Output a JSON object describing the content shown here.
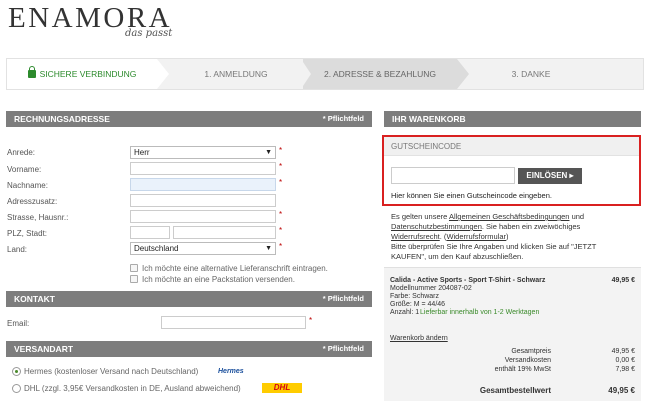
{
  "brand": {
    "name": "ENAMORA",
    "tagline": "das passt"
  },
  "steps": [
    {
      "label": "SICHERE VERBINDUNG"
    },
    {
      "label": "1. ANMELDUNG"
    },
    {
      "label": "2. ADRESSE & BEZAHLUNG"
    },
    {
      "label": "3. DANKE"
    }
  ],
  "billing": {
    "title": "RECHNUNGSADRESSE",
    "required_note": "* Pflichtfeld",
    "fields": [
      {
        "label": "Anrede:",
        "value": "Herr"
      },
      {
        "label": "Vorname:",
        "value": ""
      },
      {
        "label": "Nachname:",
        "value": ""
      },
      {
        "label": "Adresszusatz:",
        "value": ""
      },
      {
        "label": "Strasse, Hausnr.:",
        "value": ""
      },
      {
        "label": "PLZ, Stadt:",
        "value": ""
      },
      {
        "label": "Land:",
        "value": "Deutschland"
      }
    ],
    "star": "*",
    "option_alt_address": "Ich möchte eine alternative Lieferanschrift eintragen.",
    "option_packstation": "Ich möchte an eine Packstation versenden."
  },
  "contact": {
    "title": "KONTAKT",
    "required_note": "* Pflichtfeld",
    "email_label": "Email:",
    "email_value": ""
  },
  "shipping": {
    "title": "VERSANDART",
    "required_note": "* Pflichtfeld",
    "options": [
      {
        "label": "Hermes (kostenloser Versand nach Deutschland)",
        "logo": "Hermes",
        "selected": true
      },
      {
        "label": "DHL (zzgl. 3,95€ Versandkosten in DE, Ausland abweichend)",
        "logo": "DHL",
        "selected": false
      }
    ]
  },
  "cart": {
    "title": "IHR WARENKORB",
    "coupon": {
      "title": "GUTSCHEINCODE",
      "button": "EINLÖSEN ▸",
      "hint": "Hier können Sie einen Gutscheincode eingeben.",
      "value": ""
    },
    "terms": {
      "t1": "Es gelten unsere ",
      "agb": "Allgemeinen Geschäftsbedingungen",
      "t2": " und",
      "datenschutz": "Datenschutzbestimmungen",
      "t3": ". Sie haben ein zweiwöchiges",
      "widerruf": "Widerrufsrecht",
      "t4": ". (",
      "formular": "Widerrufsformular",
      "t5": ")"
    },
    "check_note_1": "Bitte überprüfen Sie Ihre Angaben und klicken Sie auf \"JETZT",
    "check_note_2": "KAUFEN\", um den Kauf abzuschließen.",
    "item": {
      "name": "Calida - Active Sports - Sport T-Shirt - Schwarz",
      "price": "49,95 €",
      "model": "Modellnummer 204087-02",
      "color": "Farbe: Schwarz",
      "size": "Größe: M = 44/46",
      "qty_label": "Anzahl: 1",
      "delivery": "Lieferbar innerhalb von 1-2 Werktagen"
    },
    "change_cart": "Warenkorb ändern",
    "totals": [
      {
        "label": "Gesamtpreis",
        "value": "49,95 €"
      },
      {
        "label": "Versandkosten",
        "value": "0,00 €"
      },
      {
        "label": "enthält 19% MwSt",
        "value": "7,98 €"
      }
    ],
    "grand_total_label": "Gesamtbestellwert",
    "grand_total_value": "49,95 €"
  },
  "colors": {
    "accent_green": "#2c8a2c",
    "highlight_red": "#d92020",
    "section_grey": "#7d7d7d"
  }
}
